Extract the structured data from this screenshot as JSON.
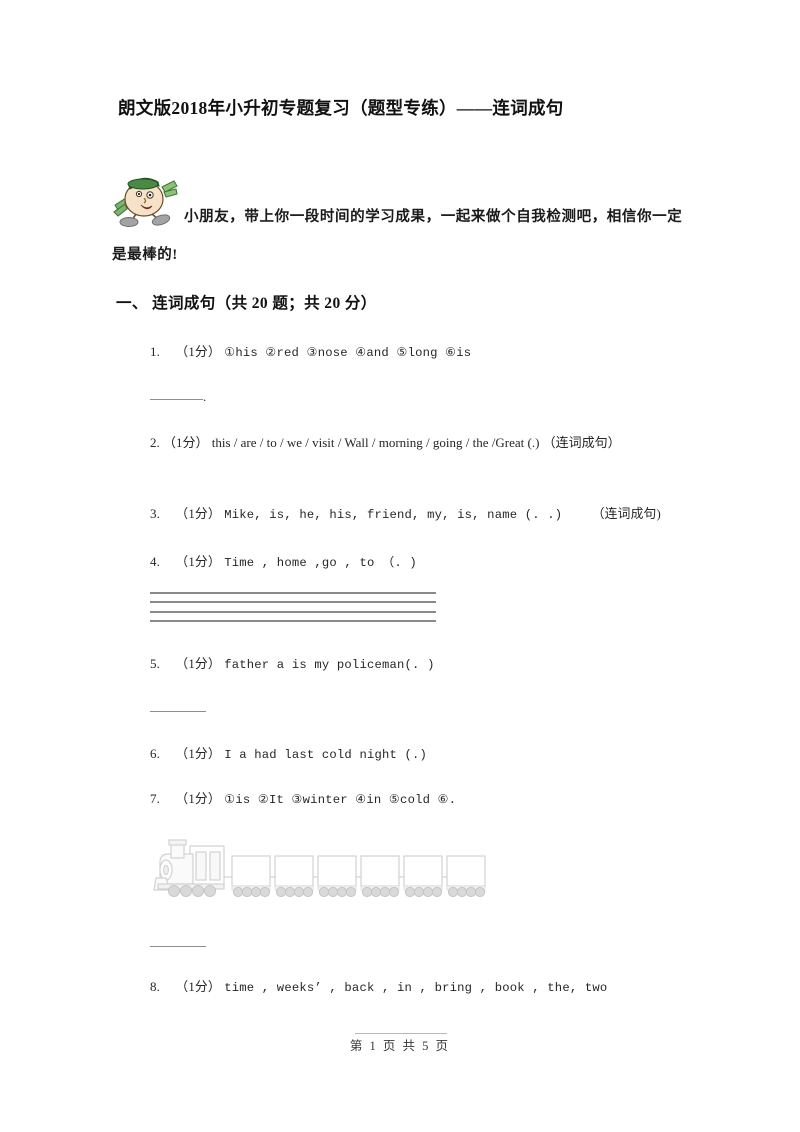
{
  "document": {
    "title": "朗文版2018年小升初专题复习（题型专练）——连词成句",
    "intro": "小朋友，带上你一段时间的学习成果，一起来做个自我检测吧，相信你一定是最棒的!",
    "mascot_icon": "cartoon-boy-with-green-hat-icon"
  },
  "section": {
    "label": "一、",
    "title": "连词成句",
    "meta": "（共 20 题；共 20 分）",
    "heading_full": "一、 连词成句（共 20 题；共 20 分）"
  },
  "questions": [
    {
      "number": "1.",
      "points": "（1分）",
      "text": "①his ②red ③nose ④and ⑤long ⑥is",
      "answer_type": "blank-with-period",
      "answer_suffix": "."
    },
    {
      "number": "2.",
      "points": "（1分）",
      "text": "this / are / to / we / visit / Wall / morning / going / the /Great (.)",
      "tag": "（连词成句）",
      "answer_type": "none"
    },
    {
      "number": "3.",
      "points": "（1分）",
      "text": "Mike, is, he, his, friend, my, is, name (. .)",
      "tag": "（连词成句)",
      "answer_type": "none"
    },
    {
      "number": "4.",
      "points": "（1分）",
      "text": "Time , home ,go , to  （. )",
      "answer_type": "writing-staff",
      "staff_lines": 4
    },
    {
      "number": "5.",
      "points": "（1分）",
      "text": "father   a   is   my   policeman(. )",
      "answer_type": "blank"
    },
    {
      "number": "6.",
      "points": "（1分）",
      "text": "I  a  had  last  cold  night  (.)",
      "answer_type": "none"
    },
    {
      "number": "7.",
      "points": "（1分）",
      "text": "①is    ②It    ③winter    ④in    ⑤cold    ⑥.",
      "answer_type": "train",
      "train_cars": 6,
      "train_icon": "train-with-empty-cars-icon"
    },
    {
      "number": "8.",
      "points": "（1分）",
      "text": "time , weeks’ , back , in , bring , book , the, two",
      "answer_type": "none"
    }
  ],
  "footer": {
    "text": "第 1 页 共 5 页"
  },
  "colors": {
    "text": "#262626",
    "title": "#111111",
    "rule": "#8a8a8a",
    "light_rule": "#b9b9b9",
    "mascot_hat": "#3f7a3f",
    "mascot_face": "#f4dfc8",
    "mascot_shoe": "#9a9a9a",
    "train_outline": "#cfcfcf"
  }
}
